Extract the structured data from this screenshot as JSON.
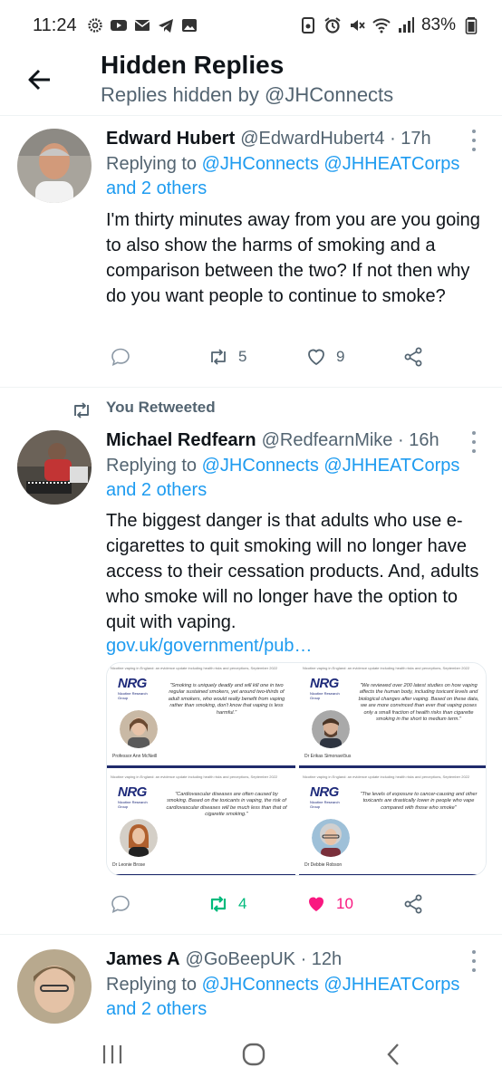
{
  "status": {
    "time": "11:24",
    "battery": "83%",
    "left_icons": [
      "settings-gear-icon",
      "youtube-icon",
      "mail-icon",
      "telegram-icon",
      "gallery-icon"
    ],
    "right_icons": [
      "notification-icon",
      "alarm-icon",
      "mute-icon",
      "wifi-icon",
      "signal-icon",
      "battery-icon"
    ]
  },
  "header": {
    "title": "Hidden Replies",
    "subtitle": "Replies hidden by @JHConnects"
  },
  "tweets": [
    {
      "name": "Edward Hubert",
      "handle": "@EdwardHubert4",
      "time": "· 17h",
      "replying_prefix": "Replying to",
      "reply_handles": "@JHConnects @JHHEATCorps",
      "reply_others": "and 2 others",
      "text": "I'm thirty minutes away from you are you going to also show the harms of smoking and a comparison between the two? If not then why do you want people to continue to smoke?",
      "retweets": "5",
      "likes": "9"
    },
    {
      "retweet_label": "You Retweeted",
      "name": "Michael Redfearn",
      "handle": "@RedfearnMike",
      "time": "· 16h",
      "replying_prefix": "Replying to",
      "reply_handles": "@JHConnects @JHHEATCorps",
      "reply_others": "and 2 others",
      "text": "The biggest danger is that adults who use e-cigarettes to quit smoking will no longer have access to their cessation products. And, adults who smoke will no longer have the option to quit with vaping.",
      "link": "gov.uk/government/pub…",
      "retweets": "4",
      "likes": "10",
      "media": {
        "caption": "Nicotine vaping in England: an evidence update including health risks and perceptions, September 2022",
        "logo": "NRG",
        "logo_sub": "Nicotine Research Group",
        "cards": [
          {
            "quote": "\"Smoking is uniquely deadly and will kill one in two regular sustained smokers, yet around two-thirds of adult smokers, who would really benefit from vaping rather than smoking, don't know that vaping is less harmful.\"",
            "person": "Professor Ann McNeill"
          },
          {
            "quote": "\"We reviewed over 200 latest studies on how vaping affects the human body, including toxicant levels and biological changes after vaping. Based on these data, we are more convinced than ever that vaping poses only a small fraction of health risks than cigarette smoking in the short to medium term.\"",
            "person": "Dr Erikas Simonavičius"
          },
          {
            "quote": "\"Cardiovascular diseases are often caused by smoking. Based on the toxicants in vaping, the risk of cardiovascular diseases will be much less than that of cigarette smoking.\"",
            "person": "Dr Leonie Brose"
          },
          {
            "quote": "\"The levels of exposure to cancer-causing and other toxicants are drastically lower in people who vape compared with those who smoke\"",
            "person": "Dr Debbie Robson"
          }
        ]
      }
    },
    {
      "name": "James A",
      "handle": "@GoBeepUK",
      "time": "· 12h",
      "replying_prefix": "Replying to",
      "reply_handles": "@JHConnects @JHHEATCorps",
      "reply_others": "and 2 others"
    }
  ],
  "colors": {
    "accent": "#1d9bf0",
    "retweet_active": "#00ba7c",
    "like_active": "#f91880",
    "muted": "#536471"
  }
}
